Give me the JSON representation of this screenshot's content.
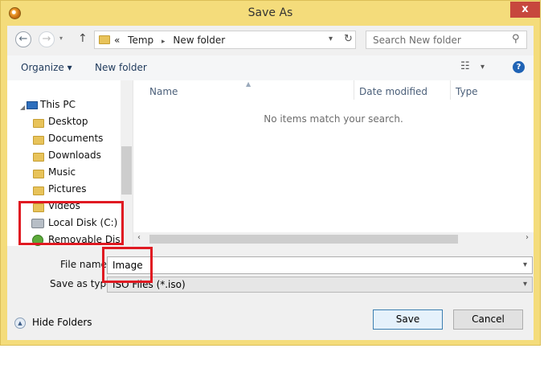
{
  "window": {
    "title": "Save As",
    "close_glyph": "x",
    "icon": "app-icon"
  },
  "address": {
    "breadcrumb_prefix": "«",
    "crumb_1": "Temp",
    "crumb_2": "New folder",
    "separator": "▸",
    "search_placeholder": "Search New folder"
  },
  "toolbar": {
    "organize_label": "Organize ▾",
    "new_folder_label": "New folder",
    "views_label": "▾"
  },
  "nav": {
    "items": [
      {
        "label": "This PC",
        "icon": "computer-icon"
      },
      {
        "label": "Desktop",
        "icon": "folder-icon"
      },
      {
        "label": "Documents",
        "icon": "folder-icon"
      },
      {
        "label": "Downloads",
        "icon": "folder-icon"
      },
      {
        "label": "Music",
        "icon": "folder-icon"
      },
      {
        "label": "Pictures",
        "icon": "folder-icon"
      },
      {
        "label": "Videos",
        "icon": "folder-icon"
      },
      {
        "label": "Local Disk (C:)",
        "icon": "disk-icon"
      },
      {
        "label": "Removable Disk (",
        "icon": "usb-icon"
      }
    ]
  },
  "content": {
    "columns": [
      "Name",
      "Date modified",
      "Type"
    ],
    "empty_message": "No items match your search."
  },
  "form": {
    "filename_label": "File name:",
    "filename_value": "Image",
    "filetype_label": "Save as type:",
    "filetype_value": "ISO Files (*.iso)"
  },
  "footer": {
    "hide_folders_label": "Hide Folders",
    "save_label": "Save",
    "cancel_label": "Cancel"
  },
  "colors": {
    "window_frame": "#f4dc7b",
    "highlight_box": "#e01a22",
    "close_button": "#c7473d"
  }
}
